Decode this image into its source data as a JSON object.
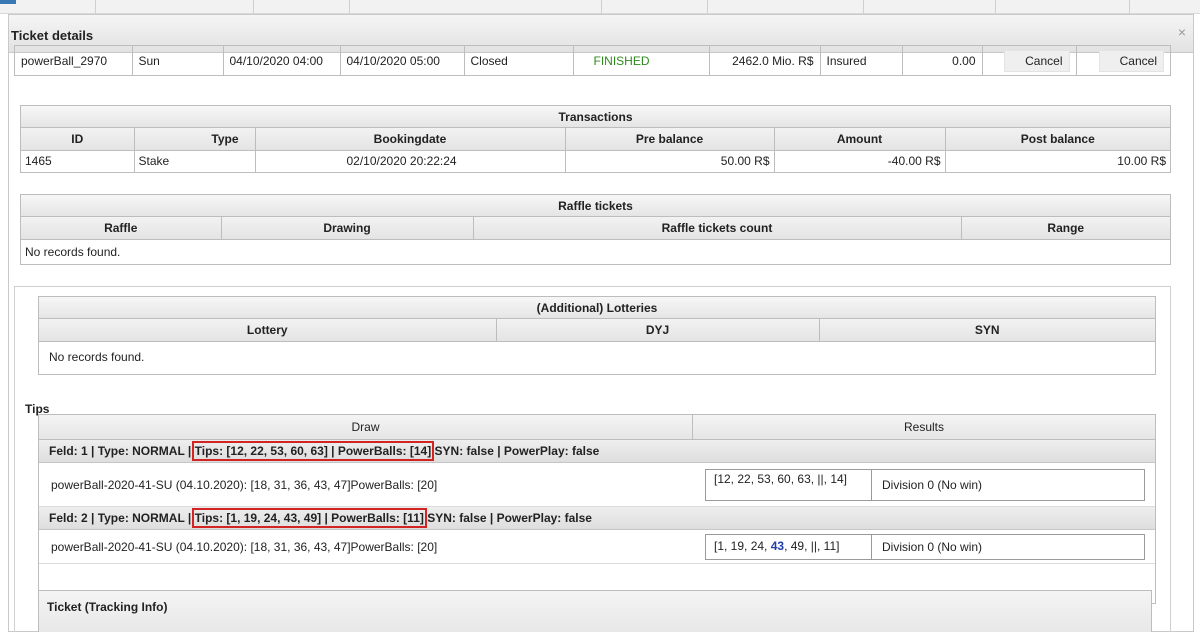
{
  "dialog": {
    "title": "Ticket details",
    "close_symbol": "×"
  },
  "ticket": {
    "id": "powerBall_2970",
    "day": "Sun",
    "start": "04/10/2020 04:00",
    "end": "04/10/2020 05:00",
    "state": "Closed",
    "status": "FINISHED",
    "jackpot": "2462.0 Mio. R$",
    "insurance": "Insured",
    "value": "0.00",
    "cancel_label_1": "Cancel",
    "cancel_label_2": "Cancel",
    "status_color": "#2f8a1c"
  },
  "transactions": {
    "title": "Transactions",
    "columns": [
      "ID",
      "Type",
      "Bookingdate",
      "Pre balance",
      "Amount",
      "Post balance"
    ],
    "rows": [
      [
        "1465",
        "Stake",
        "02/10/2020 20:22:24",
        "50.00 R$",
        "-40.00 R$",
        "10.00 R$"
      ]
    ]
  },
  "raffle": {
    "title": "Raffle tickets",
    "columns": [
      "Raffle",
      "Drawing",
      "Raffle tickets count",
      "Range"
    ],
    "empty": "No records found."
  },
  "lotteries": {
    "title": "(Additional) Lotteries",
    "columns": [
      "Lottery",
      "DYJ",
      "SYN"
    ],
    "empty": "No records found."
  },
  "tips": {
    "label": "Tips",
    "columns": [
      "Draw",
      "Results"
    ],
    "fields": [
      {
        "prefix": "Feld: 1 | Type: NORMAL | ",
        "highlight": "Tips: [12, 22, 53, 60, 63] | PowerBalls: [14]",
        "suffix": " SYN: false | PowerPlay: false",
        "draw": "powerBall-2020-41-SU (04.10.2020): [18, 31, 36, 43, 47]PowerBalls: [20]",
        "result_numbers": "[12, 22, 53, 60, 63, ||, 14]",
        "division": "Division 0 (No win)"
      },
      {
        "prefix": "Feld: 2 | Type: NORMAL | ",
        "highlight": "Tips: [1, 19, 24, 43, 49] | PowerBalls: [11]",
        "suffix": " SYN: false | PowerPlay: false",
        "draw": "powerBall-2020-41-SU (04.10.2020): [18, 31, 36, 43, 47]PowerBalls: [20]",
        "result_pre": "[1, 19, 24, ",
        "result_hit": "43",
        "result_post": ", 49, ||, 11]",
        "division": "Division 0 (No win)"
      }
    ],
    "highlight_color": "#d32424",
    "hit_color": "#1f3fa8"
  },
  "tracking": {
    "title": "Ticket (Tracking Info)"
  }
}
